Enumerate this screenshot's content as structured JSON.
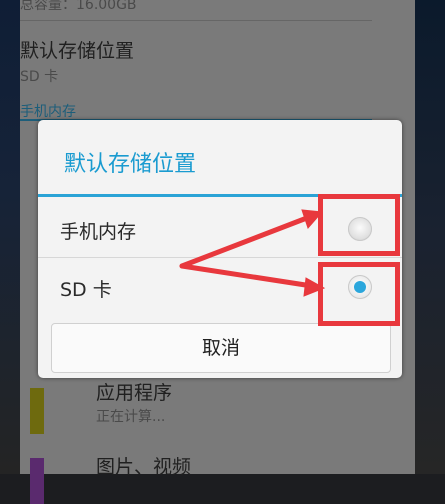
{
  "background": {
    "top_partial_text": "总容量：16.00GB",
    "setting_title": "默认存储位置",
    "setting_value": "SD 卡",
    "section_header": "手机内存",
    "item1_title": "应用程序",
    "item1_sub": "正在计算...",
    "item2_title": "图片、视频",
    "swatch_colors": [
      "#6e6a0e",
      "#5a2a6e"
    ]
  },
  "dialog": {
    "title": "默认存储位置",
    "options": [
      {
        "label": "手机内存",
        "selected": false
      },
      {
        "label": "SD 卡",
        "selected": true
      }
    ],
    "cancel_label": "取消"
  },
  "colors": {
    "accent": "#2aa6dc",
    "annotation": "#e8383d"
  }
}
